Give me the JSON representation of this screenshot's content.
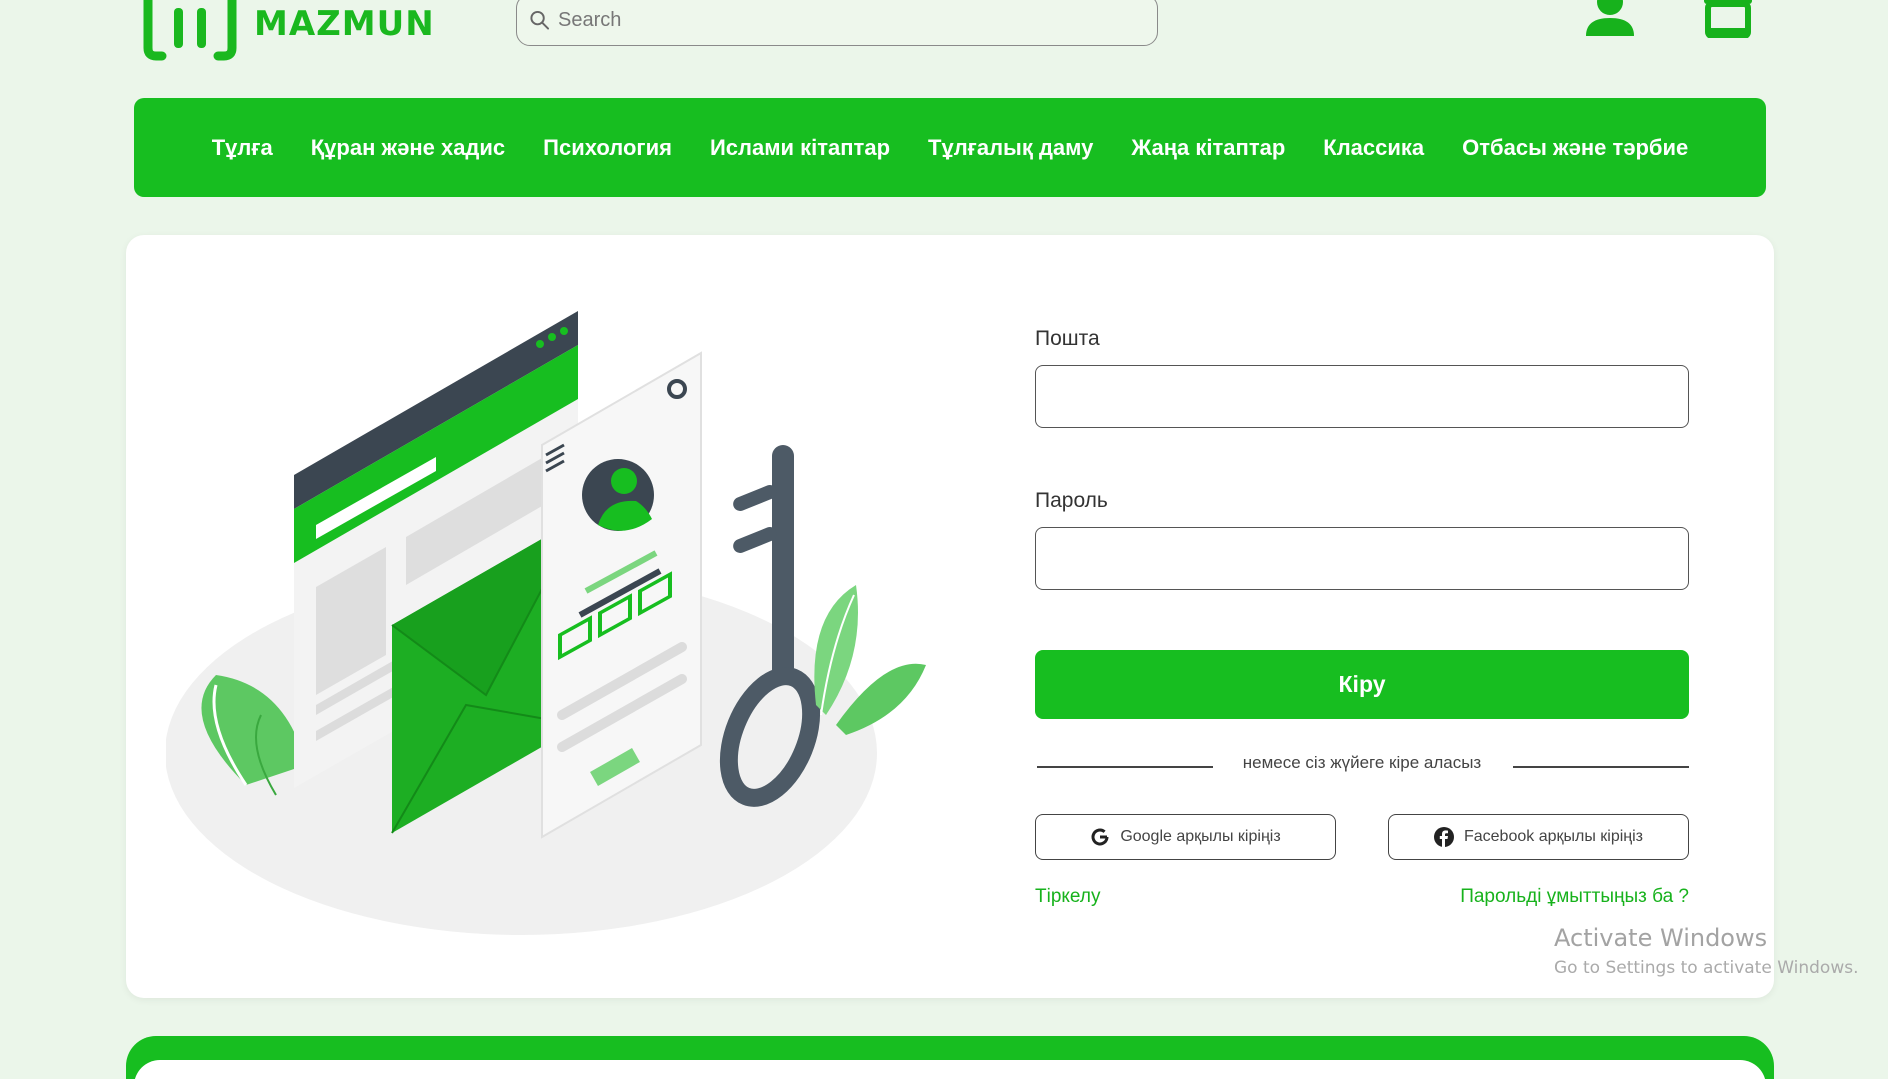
{
  "brand": {
    "name": "MAZMUN",
    "accent": "#17be20"
  },
  "search": {
    "placeholder": "Search"
  },
  "header_icons": [
    "user-icon",
    "shop-icon"
  ],
  "nav": {
    "items": [
      "Тұлға",
      "Құран және хадис",
      "Психология",
      "Ислами кітаптар",
      "Тұлғалық даму",
      "Жаңа кітаптар",
      "Классика",
      "Отбасы және тәрбие"
    ]
  },
  "login": {
    "email_label": "Пошта",
    "password_label": "Пароль",
    "submit_label": "Кіру",
    "or_text": "немесе сіз жүйеге кіре аласыз",
    "google_label": "Google арқылы кіріңіз",
    "facebook_label": "Facebook арқылы кіріңіз",
    "register_link": "Тіркелу",
    "forgot_link": "Парольді ұмыттыңыз ба ?"
  },
  "watermark": {
    "title": "Activate Windows",
    "subtitle": "Go to Settings to activate Windows."
  }
}
